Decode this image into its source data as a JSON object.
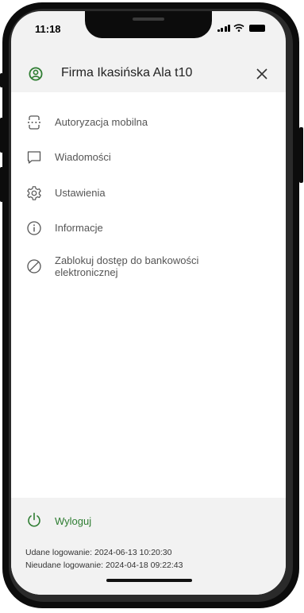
{
  "status_bar": {
    "time": "11:18"
  },
  "header": {
    "title": "Firma Ikasińska Ala t10",
    "user_icon": "user-circle-icon",
    "close_icon": "close-icon"
  },
  "menu": {
    "items": [
      {
        "label": "Autoryzacja mobilna",
        "icon": "mobile-authorization-icon"
      },
      {
        "label": "Wiadomości",
        "icon": "message-icon"
      },
      {
        "label": "Ustawienia",
        "icon": "gear-icon"
      },
      {
        "label": "Informacje",
        "icon": "info-icon"
      },
      {
        "label": "Zablokuj dostęp do bankowości elektronicznej",
        "icon": "block-icon"
      }
    ]
  },
  "logout": {
    "label": "Wyloguj",
    "icon": "power-icon"
  },
  "login_info": {
    "success": "Udane logowanie: 2024-06-13 10:20:30",
    "failed": "Nieudane logowanie: 2024-04-18 09:22:43"
  },
  "colors": {
    "accent": "#2e7d32",
    "background": "#f2f2f2",
    "menu_background": "#ffffff"
  }
}
